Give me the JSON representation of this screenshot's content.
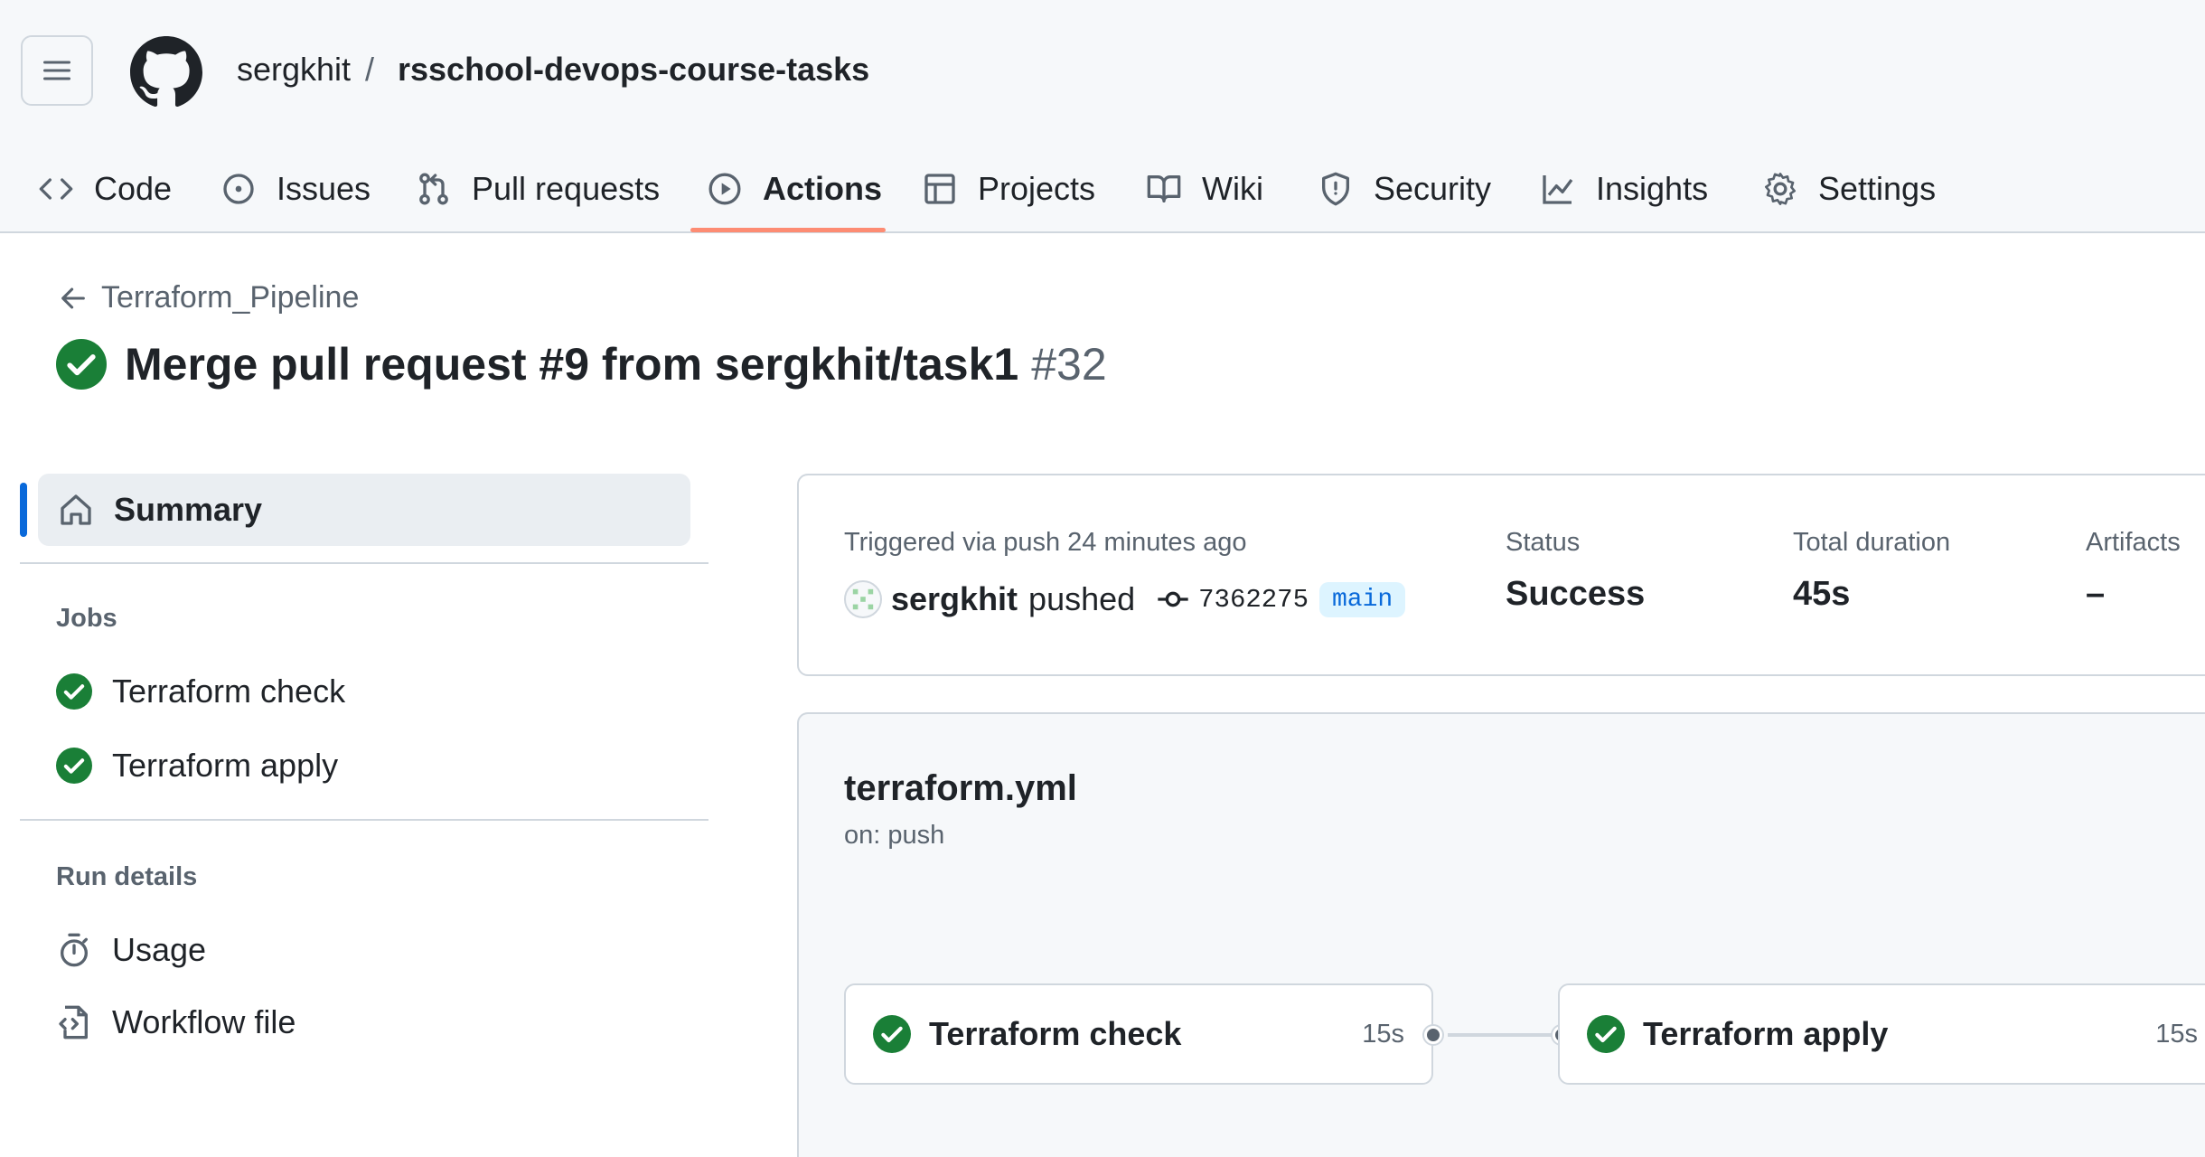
{
  "header": {
    "owner": "sergkhit",
    "separator": "/",
    "repo": "rsschool-devops-course-tasks"
  },
  "tabs": [
    {
      "label": "Code",
      "icon": "code-icon"
    },
    {
      "label": "Issues",
      "icon": "issue-opened-icon"
    },
    {
      "label": "Pull requests",
      "icon": "git-pull-request-icon"
    },
    {
      "label": "Actions",
      "icon": "play-icon",
      "active": true
    },
    {
      "label": "Projects",
      "icon": "table-icon"
    },
    {
      "label": "Wiki",
      "icon": "book-icon"
    },
    {
      "label": "Security",
      "icon": "shield-icon"
    },
    {
      "label": "Insights",
      "icon": "graph-icon"
    },
    {
      "label": "Settings",
      "icon": "gear-icon"
    }
  ],
  "run": {
    "workflow_link": "Terraform_Pipeline",
    "title": "Merge pull request #9 from sergkhit/task1",
    "number": "#32"
  },
  "sidebar": {
    "summary": "Summary",
    "jobs_heading": "Jobs",
    "jobs": [
      "Terraform check",
      "Terraform apply"
    ],
    "run_details_heading": "Run details",
    "details": [
      "Usage",
      "Workflow file"
    ]
  },
  "summary_card": {
    "trigger_text": "Triggered via push 24 minutes ago",
    "actor": "sergkhit",
    "action": "pushed",
    "commit_sha": "7362275",
    "branch": "main",
    "status_label": "Status",
    "status_value": "Success",
    "duration_label": "Total duration",
    "duration_value": "45s",
    "artifacts_label": "Artifacts",
    "artifacts_value": "–"
  },
  "workflow_graph": {
    "file": "terraform.yml",
    "trigger": "on: push",
    "jobs": [
      {
        "name": "Terraform check",
        "duration": "15s"
      },
      {
        "name": "Terraform apply",
        "duration": "15s"
      }
    ]
  },
  "colors": {
    "success": "#1a7f37",
    "accent_underline": "#fd8c73",
    "selected_bar": "#0969da",
    "branch_bg": "#ddf4ff"
  }
}
